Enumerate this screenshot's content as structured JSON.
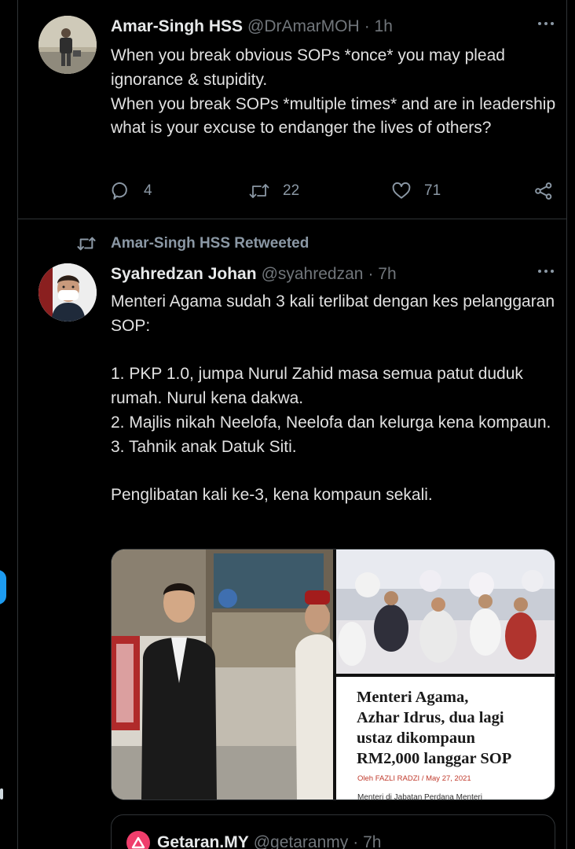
{
  "tweet1": {
    "name": "Amar-Singh HSS",
    "handle": "@DrAmarMOH",
    "time": "· 1h",
    "text": "When you break obvious SOPs *once* you may plead ignorance & stupidity.\nWhen you break SOPs *multiple times* and are in leadership what is your excuse to endanger the lives of others?",
    "replies": "4",
    "retweets": "22",
    "likes": "71"
  },
  "tweet2": {
    "retweeted_by": "Amar-Singh HSS Retweeted",
    "name": "Syahredzan Johan",
    "handle": "@syahredzan",
    "time": "· 7h",
    "text": "Menteri Agama sudah 3 kali terlibat dengan kes pelanggaran SOP:\n\n1. PKP 1.0, jumpa Nurul Zahid masa semua patut duduk rumah. Nurul kena dakwa.\n2. Majlis nikah Neelofa, Neelofa dan kelurga kena kompaun.\n3. Tahnik anak Datuk Siti.\n\nPenglibatan kali ke-3, kena kompaun sekali.",
    "news_headline": "Menteri Agama,\nAzhar Idrus, dua lagi\nustaz dikompaun\nRM2,000 langgar SOP",
    "news_byline": "Oleh FAZLI RADZI / May 27, 2021",
    "news_cut_text": "Menteri di Jabatan Perdana Menteri",
    "quote_name": "Getaran.MY",
    "quote_handle": "@getaranmy",
    "quote_time": "· 7h"
  },
  "colors": {
    "background": "#000000",
    "divider": "#2f3336",
    "muted": "#71767b",
    "accent": "#1d9bf0",
    "getaran_brand": "#ef3e6c"
  },
  "icons": [
    "more-icon",
    "reply-icon",
    "retweet-icon",
    "like-icon",
    "share-icon",
    "retweet-indicator-icon",
    "getaran-logo-icon"
  ]
}
